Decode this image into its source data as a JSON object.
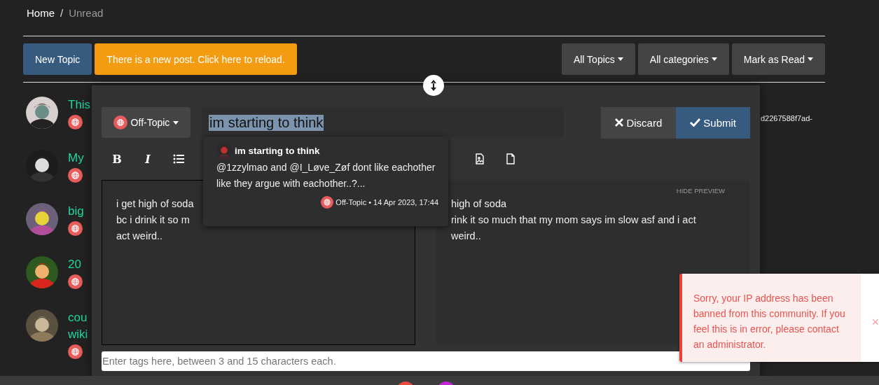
{
  "breadcrumb_separator": "/",
  "breadcrumb": [
    {
      "label": "Home",
      "selected": false
    },
    {
      "label": "Unread",
      "selected": true
    }
  ],
  "toolbar": {
    "new_topic": "New Topic",
    "reload_notice": "There is a new post. Click here to reload.",
    "filters": [
      "All Topics",
      "All categories",
      "Mark as Read"
    ]
  },
  "topics": [
    {
      "title": "This"
    },
    {
      "title": "My"
    },
    {
      "title": "big"
    },
    {
      "title": "20"
    },
    {
      "title": "cou",
      "title_line_2": "wiki"
    }
  ],
  "side_text": "d2267588f7ad-",
  "composer": {
    "category": "Off-Topic",
    "title": "im starting to think",
    "format_buttons": [
      {
        "kind": "bold",
        "label": "B"
      },
      {
        "kind": "italic",
        "label": "I"
      }
    ],
    "discard": "Discard",
    "submit": "Submit",
    "editor_lines": [
      "i get high of soda",
      "bc i drink it so m",
      "act weird.."
    ],
    "preview_toggle": "HIDE PREVIEW",
    "preview_lines": [
      "high of soda",
      "rink it so much that my mom says im slow asf and i act",
      "weird.."
    ],
    "tags_placeholder": "Enter tags here, between 3 and 15 characters each."
  },
  "suggestion": {
    "title": "im starting to think",
    "excerpt": "@1zzylmao and @I_Løve_Zøf dont like eachother like they argue with eachother..?...",
    "category": "Off-Topic",
    "separator": "•",
    "date": "14 Apr 2023, 17:44"
  },
  "toast": {
    "message": "Sorry, your IP address has been banned from this community. If you feel this is in error, please contact an administrator.",
    "close": "×"
  }
}
